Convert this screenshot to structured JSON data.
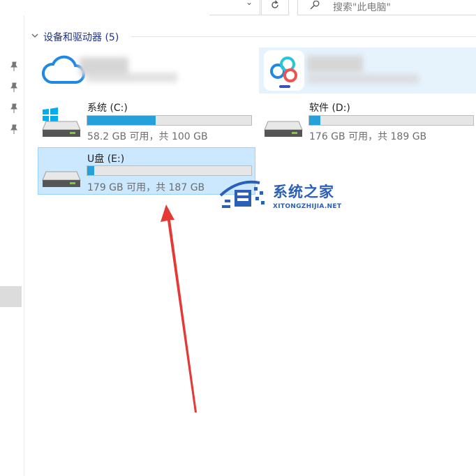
{
  "toolbar": {
    "dropdown_glyph": "⌄",
    "search_placeholder": "搜索\"此电脑\""
  },
  "devices_group": {
    "title": "设备和驱动器 (5)"
  },
  "drives": [
    {
      "id": "c",
      "name": "系统 (C:)",
      "space": "58.2 GB 可用，共 100 GB",
      "used_fraction": 0.418,
      "has_windows_logo": true
    },
    {
      "id": "d",
      "name": "软件 (D:)",
      "space": "176 GB 可用，共 189 GB",
      "used_fraction": 0.069,
      "has_windows_logo": false
    },
    {
      "id": "e",
      "name": "U盘 (E:)",
      "space": "179 GB 可用，共 187 GB",
      "used_fraction": 0.043,
      "has_windows_logo": false,
      "selected": true
    }
  ],
  "watermark": {
    "title": "系统之家",
    "subtitle": "XITONGZHIJIA.NET"
  },
  "colors": {
    "accent": "#26a0da",
    "selection_bg": "#cce8ff",
    "selection_border": "#99d1ff",
    "arrow": "#e53935",
    "watermark": "#2b5fb8"
  }
}
